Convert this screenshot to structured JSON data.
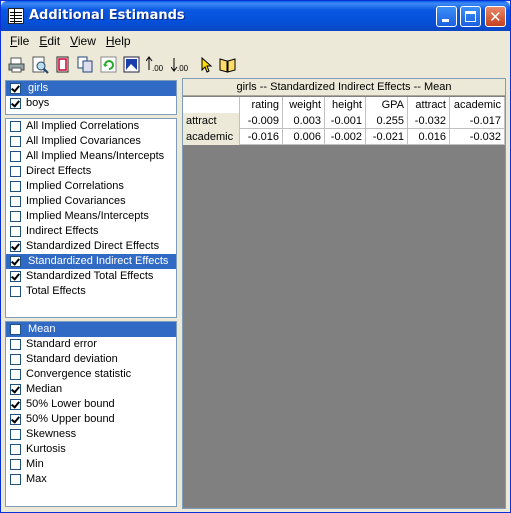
{
  "window": {
    "title": "Additional Estimands"
  },
  "menu": [
    {
      "label": "File",
      "accel": "F",
      "rest": "ile"
    },
    {
      "label": "Edit",
      "accel": "E",
      "rest": "dit"
    },
    {
      "label": "View",
      "accel": "V",
      "rest": "iew"
    },
    {
      "label": "Help",
      "accel": "H",
      "rest": "elp"
    }
  ],
  "toolbar": {
    "icons": [
      "print-icon",
      "print-preview-icon",
      "page-setup-icon",
      "copy-icon",
      "refresh-icon",
      "image-icon",
      "increase-decimals-icon",
      "decrease-decimals-icon",
      "help-pointer-icon",
      "help-book-icon"
    ],
    "decimal_text": ".00"
  },
  "groups": [
    {
      "label": "girls",
      "checked": true,
      "selected": true
    },
    {
      "label": "boys",
      "checked": true,
      "selected": false
    }
  ],
  "estimands": [
    {
      "label": "All Implied Correlations",
      "checked": false,
      "selected": false
    },
    {
      "label": "All Implied Covariances",
      "checked": false,
      "selected": false
    },
    {
      "label": "All Implied Means/Intercepts",
      "checked": false,
      "selected": false
    },
    {
      "label": "Direct Effects",
      "checked": false,
      "selected": false
    },
    {
      "label": "Implied Correlations",
      "checked": false,
      "selected": false
    },
    {
      "label": "Implied Covariances",
      "checked": false,
      "selected": false
    },
    {
      "label": "Implied Means/Intercepts",
      "checked": false,
      "selected": false
    },
    {
      "label": "Indirect Effects",
      "checked": false,
      "selected": false
    },
    {
      "label": "Standardized Direct Effects",
      "checked": true,
      "selected": false
    },
    {
      "label": "Standardized Indirect Effects",
      "checked": true,
      "selected": true
    },
    {
      "label": "Standardized Total Effects",
      "checked": true,
      "selected": false
    },
    {
      "label": "Total Effects",
      "checked": false,
      "selected": false
    }
  ],
  "statistics": [
    {
      "label": "Mean",
      "checked": false,
      "selected": true
    },
    {
      "label": "Standard error",
      "checked": false,
      "selected": false
    },
    {
      "label": "Standard deviation",
      "checked": false,
      "selected": false
    },
    {
      "label": "Convergence statistic",
      "checked": false,
      "selected": false
    },
    {
      "label": "Median",
      "checked": true,
      "selected": false
    },
    {
      "label": "50% Lower bound",
      "checked": true,
      "selected": false
    },
    {
      "label": "50% Upper bound",
      "checked": true,
      "selected": false
    },
    {
      "label": "Skewness",
      "checked": false,
      "selected": false
    },
    {
      "label": "Kurtosis",
      "checked": false,
      "selected": false
    },
    {
      "label": "Min",
      "checked": false,
      "selected": false
    },
    {
      "label": "Max",
      "checked": false,
      "selected": false
    }
  ],
  "table": {
    "title": "girls -- Standardized Indirect Effects -- Mean",
    "columns": [
      "rating",
      "weight",
      "height",
      "GPA",
      "attract",
      "academic"
    ],
    "rows": [
      {
        "label": "attract",
        "values": [
          "-0.009",
          "0.003",
          "-0.001",
          "0.255",
          "-0.032",
          "-0.017"
        ]
      },
      {
        "label": "academic",
        "values": [
          "-0.016",
          "0.006",
          "-0.002",
          "-0.021",
          "0.016",
          "-0.032"
        ]
      }
    ]
  }
}
